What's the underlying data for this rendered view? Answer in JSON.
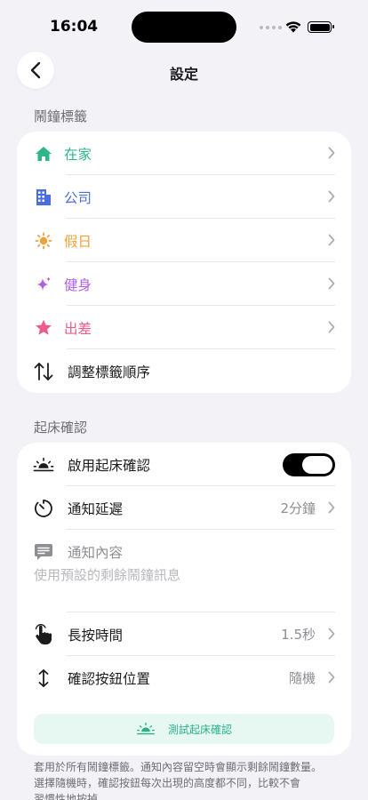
{
  "status_bar": {
    "time": "16:04"
  },
  "nav": {
    "title": "設定"
  },
  "labels_section": {
    "header": "鬧鐘標籤",
    "items": [
      {
        "label": "在家",
        "icon": "house-icon",
        "color": "#2fb58b"
      },
      {
        "label": "公司",
        "icon": "building-icon",
        "color": "#4a6ee0"
      },
      {
        "label": "假日",
        "icon": "sun-icon",
        "color": "#f2a13a"
      },
      {
        "label": "健身",
        "icon": "sparkles-icon",
        "color": "#b15fe0"
      },
      {
        "label": "出差",
        "icon": "star-icon",
        "color": "#ee5a8a"
      }
    ],
    "reorder_label": "調整標籤順序"
  },
  "wake_section": {
    "header": "起床確認",
    "enable_label": "啟用起床確認",
    "enable_on": true,
    "delay_label": "通知延遲",
    "delay_value": "2分鐘",
    "content_label": "通知內容",
    "content_hint": "使用預設的剩餘鬧鐘訊息",
    "press_label": "長按時間",
    "press_value": "1.5秒",
    "position_label": "確認按鈕位置",
    "position_value": "隨機",
    "test_button": "測試起床確認",
    "accent": "#2db08a"
  },
  "footer": {
    "line1": "套用於所有鬧鐘標籤。通知內容留空時會顯示剩餘鬧鐘數量。",
    "line2": "選擇隨機時，確認按鈕每次出現的高度都不同，比較不會",
    "line3": "習慣性地按掉。"
  }
}
